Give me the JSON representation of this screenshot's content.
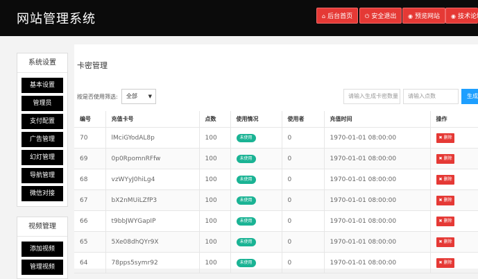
{
  "header": {
    "title": "网站管理系统",
    "buttons": [
      {
        "label": "后台首页",
        "icon": "home-icon"
      },
      {
        "label": "安全退出",
        "icon": "logout-icon"
      },
      {
        "label": "预览网站",
        "icon": "eye-icon"
      },
      {
        "label": "技术论坛",
        "icon": "forum-icon"
      }
    ]
  },
  "sidebar": {
    "system_title": "系统设置",
    "system_items": [
      "基本设置",
      "管理员",
      "支付配置",
      "广告管理",
      "幻灯管理",
      "导航管理",
      "微信对接"
    ],
    "video_title": "视频管理",
    "video_items": [
      "添加视频",
      "管理视频"
    ]
  },
  "main": {
    "title": "卡密管理",
    "filter_label": "按是否使用筛选:",
    "filter_value": "全部",
    "count_placeholder": "请输入生成卡密数量",
    "points_placeholder": "请输入点数",
    "generate_label": "生成"
  },
  "table": {
    "headers": [
      "编号",
      "充值卡号",
      "点数",
      "使用情况",
      "使用者",
      "充值时间",
      "操作"
    ],
    "delete_label": "删除",
    "rows": [
      {
        "id": "70",
        "card": "lMciGYodAL8p",
        "points": "100",
        "status": "未使用",
        "user": "0",
        "time": "1970-01-01 08:00:00"
      },
      {
        "id": "69",
        "card": "0p0RpomnRFfw",
        "points": "100",
        "status": "未使用",
        "user": "0",
        "time": "1970-01-01 08:00:00"
      },
      {
        "id": "68",
        "card": "vzWYyJ0hiLg4",
        "points": "100",
        "status": "未使用",
        "user": "0",
        "time": "1970-01-01 08:00:00"
      },
      {
        "id": "67",
        "card": "bX2nMUiLZfP3",
        "points": "100",
        "status": "未使用",
        "user": "0",
        "time": "1970-01-01 08:00:00"
      },
      {
        "id": "66",
        "card": "t9bbJWYGapIP",
        "points": "100",
        "status": "未使用",
        "user": "0",
        "time": "1970-01-01 08:00:00"
      },
      {
        "id": "65",
        "card": "5Xe08dhQYr9X",
        "points": "100",
        "status": "未使用",
        "user": "0",
        "time": "1970-01-01 08:00:00"
      },
      {
        "id": "64",
        "card": "78pps5symr92",
        "points": "100",
        "status": "未使用",
        "user": "0",
        "time": "1970-01-01 08:00:00"
      }
    ]
  }
}
